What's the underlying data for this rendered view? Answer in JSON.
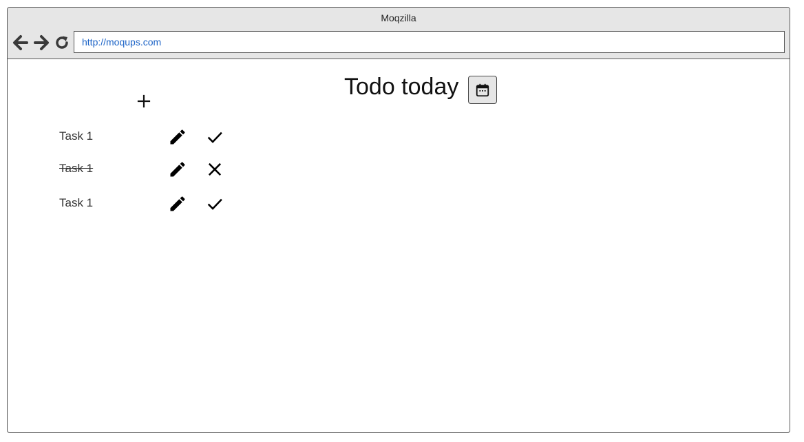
{
  "window": {
    "title": "Moqzilla"
  },
  "toolbar": {
    "back_icon": "arrow-left-icon",
    "forward_icon": "arrow-right-icon",
    "reload_icon": "reload-icon",
    "url": "http://moqups.com"
  },
  "page": {
    "title": "Todo today",
    "calendar_icon": "calendar-icon",
    "add_icon": "plus-icon",
    "tasks": [
      {
        "label": "Task 1",
        "completed": false,
        "edit_icon": "pencil-icon",
        "status_icon": "check-icon"
      },
      {
        "label": "Task 1",
        "completed": true,
        "edit_icon": "pencil-icon",
        "status_icon": "close-icon"
      },
      {
        "label": "Task 1",
        "completed": false,
        "edit_icon": "pencil-icon",
        "status_icon": "check-icon"
      }
    ]
  },
  "colors": {
    "chrome_bg": "#e6e6e6",
    "url_text": "#1a62c6",
    "border": "#555555",
    "icon": "#000000"
  }
}
